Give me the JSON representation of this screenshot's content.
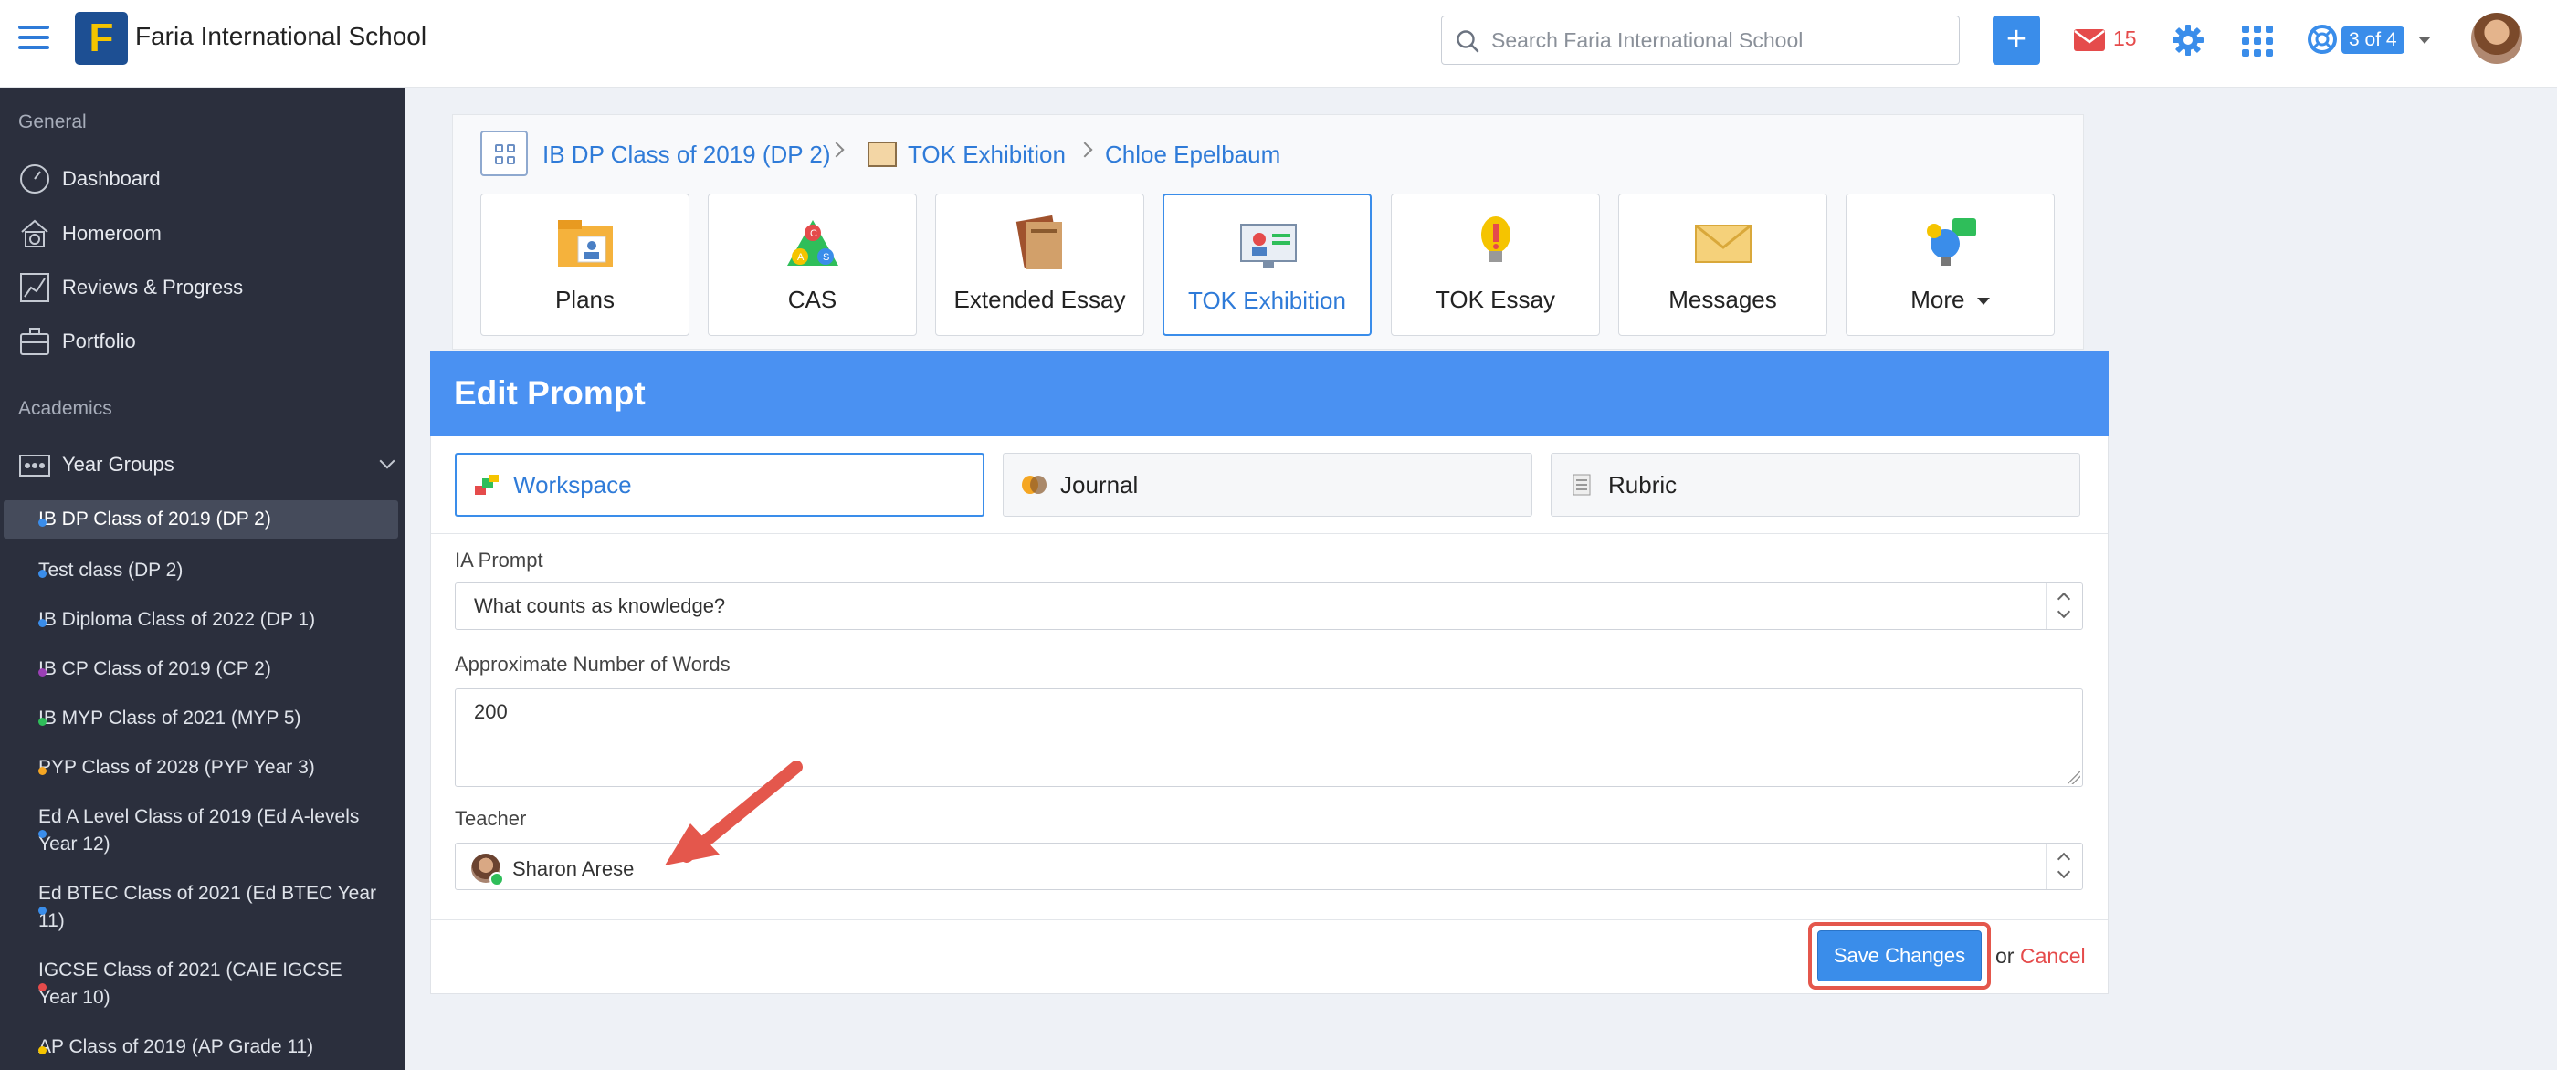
{
  "app": {
    "school_name": "Faria International School",
    "logo_letter": "F",
    "search_placeholder": "Search Faria International School",
    "add_label": "+",
    "mail_count": "15",
    "help_badge": "3 of 4",
    "accent_color": "#3a8dea"
  },
  "sidebar": {
    "general_heading": "General",
    "general_items": [
      {
        "label": "Dashboard",
        "icon": "dashboard-icon"
      },
      {
        "label": "Homeroom",
        "icon": "homeroom-icon"
      },
      {
        "label": "Reviews & Progress",
        "icon": "chart-icon"
      },
      {
        "label": "Portfolio",
        "icon": "briefcase-icon"
      }
    ],
    "academics_heading": "Academics",
    "year_groups_label": "Year Groups",
    "classes": [
      {
        "label": "IB DP Class of 2019 (DP 2)",
        "color": "#3a8dea",
        "active": true
      },
      {
        "label": "Test class (DP 2)",
        "color": "#3a8dea"
      },
      {
        "label": "IB Diploma Class of 2022 (DP 1)",
        "color": "#3a8dea"
      },
      {
        "label": "IB CP Class of 2019 (CP 2)",
        "color": "#9b3fb5"
      },
      {
        "label": "IB MYP Class of 2021 (MYP 5)",
        "color": "#2fbe5a"
      },
      {
        "label": "PYP Class of 2028 (PYP Year 3)",
        "color": "#f5a623"
      },
      {
        "label": "Ed A Level Class of 2019 (Ed A-levels Year 12)",
        "color": "#3a8dea"
      },
      {
        "label": "Ed BTEC Class of 2021 (Ed BTEC Year 11)",
        "color": "#3a8dea"
      },
      {
        "label": "IGCSE Class of 2021 (CAIE IGCSE Year 10)",
        "color": "#e54b4b"
      },
      {
        "label": "AP Class of 2019 (AP Grade 11)",
        "color": "#f5c400"
      }
    ]
  },
  "breadcrumb": {
    "class": "IB DP Class of 2019 (DP 2)",
    "section": "TOK Exhibition",
    "student": "Chloe Epelbaum"
  },
  "apps": [
    {
      "label": "Plans",
      "icon": "plans-icon"
    },
    {
      "label": "CAS",
      "icon": "cas-icon"
    },
    {
      "label": "Extended Essay",
      "icon": "books-icon"
    },
    {
      "label": "TOK Exhibition",
      "icon": "exhibition-icon",
      "active": true
    },
    {
      "label": "TOK Essay",
      "icon": "lightbulb-icon"
    },
    {
      "label": "Messages",
      "icon": "envelope-icon"
    },
    {
      "label": "More",
      "icon": "more-icon"
    }
  ],
  "edit": {
    "title": "Edit Prompt",
    "tabs": [
      {
        "label": "Workspace",
        "active": true
      },
      {
        "label": "Journal"
      },
      {
        "label": "Rubric"
      }
    ],
    "prompt_label": "IA Prompt",
    "prompt_value": "What counts as knowledge?",
    "words_label": "Approximate Number of Words",
    "words_value": "200",
    "teacher_label": "Teacher",
    "teacher_value": "Sharon Arese",
    "save_label": "Save Changes",
    "or_text": "or",
    "cancel_label": "Cancel"
  }
}
